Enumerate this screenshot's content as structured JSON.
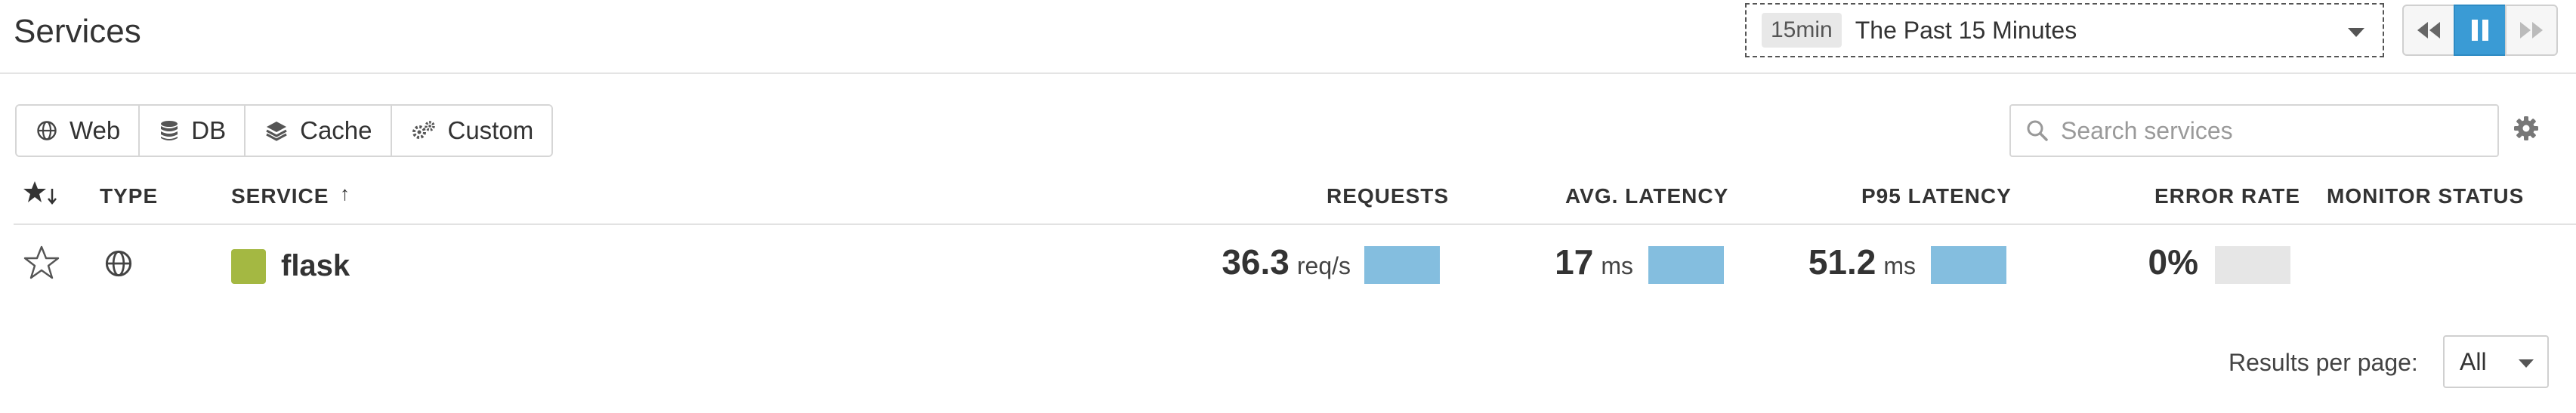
{
  "header": {
    "title": "Services",
    "time_range": {
      "badge": "15min",
      "label": "The Past 15 Minutes"
    }
  },
  "playback": {
    "buttons": [
      {
        "name": "rewind",
        "icon": "rewind-icon"
      },
      {
        "name": "pause",
        "icon": "pause-icon",
        "active": true
      },
      {
        "name": "forward",
        "icon": "fast-forward-icon"
      }
    ],
    "active_color": "#3a9bd5"
  },
  "filters": [
    {
      "label": "Web",
      "icon": "globe-icon"
    },
    {
      "label": "DB",
      "icon": "database-icon"
    },
    {
      "label": "Cache",
      "icon": "layers-icon"
    },
    {
      "label": "Custom",
      "icon": "gears-icon"
    }
  ],
  "search": {
    "placeholder": "Search services",
    "value": ""
  },
  "table": {
    "columns": {
      "type": "TYPE",
      "service": "SERVICE",
      "service_sort": "↑",
      "requests": "REQUESTS",
      "avg_latency": "AVG. LATENCY",
      "p95_latency": "P95 LATENCY",
      "error_rate": "ERROR RATE",
      "monitor_status": "MONITOR STATUS"
    },
    "sort_icon": "star-sort-down-icon",
    "rows": [
      {
        "favorite": false,
        "type_icon": "globe-icon",
        "service": "flask",
        "service_color": "#a4b842",
        "requests": {
          "value": "36.3",
          "unit": "req/s",
          "bar_fraction": 1.0
        },
        "avg_latency": {
          "value": "17",
          "unit": "ms",
          "bar_fraction": 1.0
        },
        "p95_latency": {
          "value": "51.2",
          "unit": "ms",
          "bar_fraction": 1.0
        },
        "error_rate": {
          "value": "0%",
          "bar_fraction": 0.0
        },
        "monitor_status": ""
      }
    ],
    "bar_color": "#84bedf"
  },
  "footer": {
    "results_per_page_label": "Results per page:",
    "results_per_page_value": "All"
  }
}
